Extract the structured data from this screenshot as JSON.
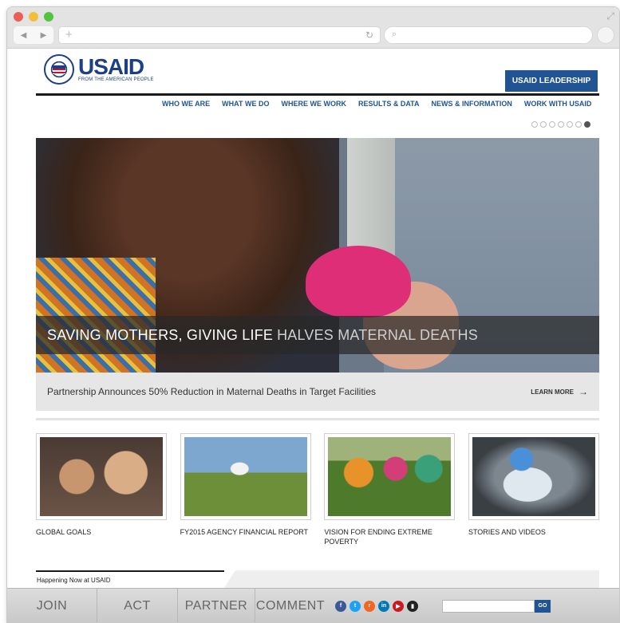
{
  "browser": {
    "lights": [
      "#ec5f57",
      "#f4be3c",
      "#52c43f"
    ]
  },
  "header": {
    "brand": "USAID",
    "tagline": "FROM THE AMERICAN PEOPLE",
    "leadership_button": "USAID LEADERSHIP"
  },
  "nav": {
    "items": [
      "WHO WE ARE",
      "WHAT WE DO",
      "WHERE WE WORK",
      "RESULTS & DATA",
      "NEWS & INFORMATION",
      "WORK WITH USAID"
    ]
  },
  "slider": {
    "dot_count": 7,
    "active_dot": 7
  },
  "hero": {
    "caption_bold": "SAVING MOTHERS, GIVING LIFE",
    "caption_light": "HALVES MATERNAL DEATHS",
    "subtitle": "Partnership Announces 50% Reduction in Maternal Deaths in Target Facilities",
    "learn_more": "LEARN MORE"
  },
  "tiles": [
    {
      "label": "GLOBAL GOALS"
    },
    {
      "label": "FY2015 AGENCY FINANCIAL REPORT"
    },
    {
      "label": "VISION FOR ENDING EXTREME POVERTY"
    },
    {
      "label": "STORIES AND VIDEOS"
    }
  ],
  "happening": {
    "title": "Happening Now at USAID"
  },
  "footer": {
    "links": [
      "JOIN",
      "ACT",
      "PARTNER",
      "COMMENT"
    ],
    "social": [
      {
        "icon": "facebook-icon",
        "color": "#3b5998",
        "glyph": "f"
      },
      {
        "icon": "twitter-icon",
        "color": "#1da1f2",
        "glyph": "t"
      },
      {
        "icon": "rss-icon",
        "color": "#f26522",
        "glyph": "r"
      },
      {
        "icon": "linkedin-icon",
        "color": "#0077b5",
        "glyph": "in"
      },
      {
        "icon": "youtube-icon",
        "color": "#cc181e",
        "glyph": "▶"
      },
      {
        "icon": "mobile-icon",
        "color": "#222222",
        "glyph": "▮"
      }
    ],
    "go_button": "GO"
  },
  "colors": {
    "brand_blue": "#205493",
    "logo_blue": "#1c3f86"
  }
}
